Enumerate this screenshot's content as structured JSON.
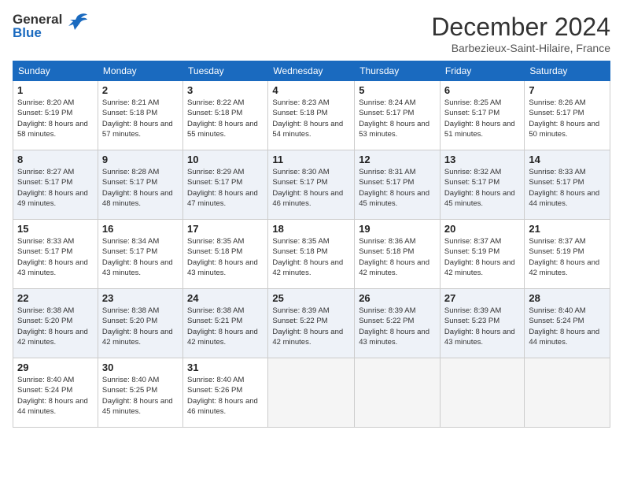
{
  "header": {
    "logo_line1": "General",
    "logo_line2": "Blue",
    "title": "December 2024",
    "location": "Barbezieux-Saint-Hilaire, France"
  },
  "days_of_week": [
    "Sunday",
    "Monday",
    "Tuesday",
    "Wednesday",
    "Thursday",
    "Friday",
    "Saturday"
  ],
  "weeks": [
    [
      {
        "day": 1,
        "sunrise": "Sunrise: 8:20 AM",
        "sunset": "Sunset: 5:19 PM",
        "daylight": "Daylight: 8 hours and 58 minutes."
      },
      {
        "day": 2,
        "sunrise": "Sunrise: 8:21 AM",
        "sunset": "Sunset: 5:18 PM",
        "daylight": "Daylight: 8 hours and 57 minutes."
      },
      {
        "day": 3,
        "sunrise": "Sunrise: 8:22 AM",
        "sunset": "Sunset: 5:18 PM",
        "daylight": "Daylight: 8 hours and 55 minutes."
      },
      {
        "day": 4,
        "sunrise": "Sunrise: 8:23 AM",
        "sunset": "Sunset: 5:18 PM",
        "daylight": "Daylight: 8 hours and 54 minutes."
      },
      {
        "day": 5,
        "sunrise": "Sunrise: 8:24 AM",
        "sunset": "Sunset: 5:17 PM",
        "daylight": "Daylight: 8 hours and 53 minutes."
      },
      {
        "day": 6,
        "sunrise": "Sunrise: 8:25 AM",
        "sunset": "Sunset: 5:17 PM",
        "daylight": "Daylight: 8 hours and 51 minutes."
      },
      {
        "day": 7,
        "sunrise": "Sunrise: 8:26 AM",
        "sunset": "Sunset: 5:17 PM",
        "daylight": "Daylight: 8 hours and 50 minutes."
      }
    ],
    [
      {
        "day": 8,
        "sunrise": "Sunrise: 8:27 AM",
        "sunset": "Sunset: 5:17 PM",
        "daylight": "Daylight: 8 hours and 49 minutes."
      },
      {
        "day": 9,
        "sunrise": "Sunrise: 8:28 AM",
        "sunset": "Sunset: 5:17 PM",
        "daylight": "Daylight: 8 hours and 48 minutes."
      },
      {
        "day": 10,
        "sunrise": "Sunrise: 8:29 AM",
        "sunset": "Sunset: 5:17 PM",
        "daylight": "Daylight: 8 hours and 47 minutes."
      },
      {
        "day": 11,
        "sunrise": "Sunrise: 8:30 AM",
        "sunset": "Sunset: 5:17 PM",
        "daylight": "Daylight: 8 hours and 46 minutes."
      },
      {
        "day": 12,
        "sunrise": "Sunrise: 8:31 AM",
        "sunset": "Sunset: 5:17 PM",
        "daylight": "Daylight: 8 hours and 45 minutes."
      },
      {
        "day": 13,
        "sunrise": "Sunrise: 8:32 AM",
        "sunset": "Sunset: 5:17 PM",
        "daylight": "Daylight: 8 hours and 45 minutes."
      },
      {
        "day": 14,
        "sunrise": "Sunrise: 8:33 AM",
        "sunset": "Sunset: 5:17 PM",
        "daylight": "Daylight: 8 hours and 44 minutes."
      }
    ],
    [
      {
        "day": 15,
        "sunrise": "Sunrise: 8:33 AM",
        "sunset": "Sunset: 5:17 PM",
        "daylight": "Daylight: 8 hours and 43 minutes."
      },
      {
        "day": 16,
        "sunrise": "Sunrise: 8:34 AM",
        "sunset": "Sunset: 5:17 PM",
        "daylight": "Daylight: 8 hours and 43 minutes."
      },
      {
        "day": 17,
        "sunrise": "Sunrise: 8:35 AM",
        "sunset": "Sunset: 5:18 PM",
        "daylight": "Daylight: 8 hours and 43 minutes."
      },
      {
        "day": 18,
        "sunrise": "Sunrise: 8:35 AM",
        "sunset": "Sunset: 5:18 PM",
        "daylight": "Daylight: 8 hours and 42 minutes."
      },
      {
        "day": 19,
        "sunrise": "Sunrise: 8:36 AM",
        "sunset": "Sunset: 5:18 PM",
        "daylight": "Daylight: 8 hours and 42 minutes."
      },
      {
        "day": 20,
        "sunrise": "Sunrise: 8:37 AM",
        "sunset": "Sunset: 5:19 PM",
        "daylight": "Daylight: 8 hours and 42 minutes."
      },
      {
        "day": 21,
        "sunrise": "Sunrise: 8:37 AM",
        "sunset": "Sunset: 5:19 PM",
        "daylight": "Daylight: 8 hours and 42 minutes."
      }
    ],
    [
      {
        "day": 22,
        "sunrise": "Sunrise: 8:38 AM",
        "sunset": "Sunset: 5:20 PM",
        "daylight": "Daylight: 8 hours and 42 minutes."
      },
      {
        "day": 23,
        "sunrise": "Sunrise: 8:38 AM",
        "sunset": "Sunset: 5:20 PM",
        "daylight": "Daylight: 8 hours and 42 minutes."
      },
      {
        "day": 24,
        "sunrise": "Sunrise: 8:38 AM",
        "sunset": "Sunset: 5:21 PM",
        "daylight": "Daylight: 8 hours and 42 minutes."
      },
      {
        "day": 25,
        "sunrise": "Sunrise: 8:39 AM",
        "sunset": "Sunset: 5:22 PM",
        "daylight": "Daylight: 8 hours and 42 minutes."
      },
      {
        "day": 26,
        "sunrise": "Sunrise: 8:39 AM",
        "sunset": "Sunset: 5:22 PM",
        "daylight": "Daylight: 8 hours and 43 minutes."
      },
      {
        "day": 27,
        "sunrise": "Sunrise: 8:39 AM",
        "sunset": "Sunset: 5:23 PM",
        "daylight": "Daylight: 8 hours and 43 minutes."
      },
      {
        "day": 28,
        "sunrise": "Sunrise: 8:40 AM",
        "sunset": "Sunset: 5:24 PM",
        "daylight": "Daylight: 8 hours and 44 minutes."
      }
    ],
    [
      {
        "day": 29,
        "sunrise": "Sunrise: 8:40 AM",
        "sunset": "Sunset: 5:24 PM",
        "daylight": "Daylight: 8 hours and 44 minutes."
      },
      {
        "day": 30,
        "sunrise": "Sunrise: 8:40 AM",
        "sunset": "Sunset: 5:25 PM",
        "daylight": "Daylight: 8 hours and 45 minutes."
      },
      {
        "day": 31,
        "sunrise": "Sunrise: 8:40 AM",
        "sunset": "Sunset: 5:26 PM",
        "daylight": "Daylight: 8 hours and 46 minutes."
      },
      null,
      null,
      null,
      null
    ]
  ]
}
